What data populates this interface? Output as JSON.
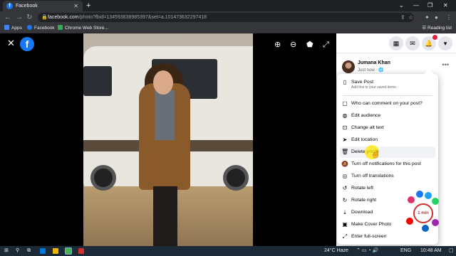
{
  "browser": {
    "tab_title": "Facebook",
    "tab_favicon": "f",
    "url_host": "facebook.com",
    "url_path": "/photo?fbid=134593838985397&set=a.101473632297418",
    "bookmarks": [
      {
        "label": "Apps",
        "icon": "apps-grid-icon",
        "color": "#4285f4"
      },
      {
        "label": "Facebook",
        "icon": "facebook-icon",
        "color": "#1877f2"
      },
      {
        "label": "Chrome Web Store...",
        "icon": "chrome-web-store-icon",
        "color": "#34a853"
      }
    ],
    "reading_list": "Reading list"
  },
  "post": {
    "author": "Jumana Khan",
    "meta": "Just now · 🌐"
  },
  "menu": {
    "items": [
      {
        "label": "Save Post",
        "sub": "Add this to your saved items.",
        "icon": "bookmark-icon"
      },
      {
        "label": "Who can comment on your post?",
        "icon": "comment-icon"
      },
      {
        "label": "Edit audience",
        "icon": "globe-icon"
      },
      {
        "label": "Change alt text",
        "icon": "alt-text-icon"
      },
      {
        "label": "Edit location",
        "icon": "location-icon"
      },
      {
        "label": "Delete photo",
        "icon": "trash-icon"
      },
      {
        "label": "Turn off notifications for this post",
        "icon": "bell-off-icon"
      },
      {
        "label": "Turn off translations",
        "icon": "translate-icon"
      },
      {
        "label": "Rotate left",
        "icon": "rotate-left-icon"
      },
      {
        "label": "Rotate right",
        "icon": "rotate-right-icon"
      },
      {
        "label": "Download",
        "icon": "download-icon"
      },
      {
        "label": "Make Cover Photo",
        "icon": "image-icon"
      },
      {
        "label": "Enter full-screen",
        "icon": "fullscreen-icon"
      }
    ]
  },
  "sticker": {
    "label": "1 min"
  },
  "taskbar": {
    "weather": "24°C  Haze",
    "lang": "ENG",
    "time": "10:48 AM"
  },
  "colors": {
    "facebook_blue": "#1877f2",
    "highlight": "#ffe600"
  }
}
